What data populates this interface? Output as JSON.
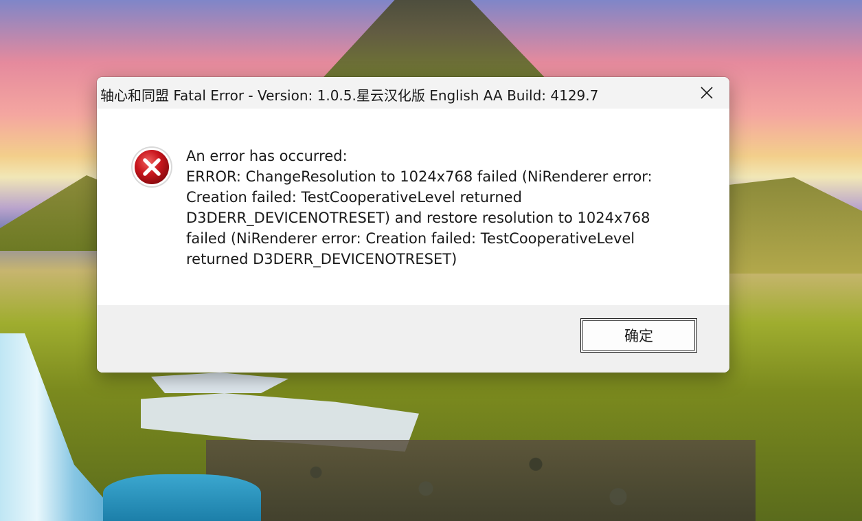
{
  "window": {
    "title": "轴心和同盟 Fatal Error - Version: 1.0.5.星云汉化版 English AA Build: 4129.7"
  },
  "dialog": {
    "icon": "error-icon",
    "message_lines": [
      "An error has occurred:",
      "ERROR: ChangeResolution to 1024x768 failed (NiRenderer error:",
      "Creation failed: TestCooperativeLevel returned",
      "D3DERR_DEVICENOTRESET) and restore resolution to 1024x768",
      "failed (NiRenderer error: Creation failed: TestCooperativeLevel",
      "returned D3DERR_DEVICENOTRESET)"
    ],
    "ok_label": "确定"
  },
  "colors": {
    "error_red": "#c8161d",
    "titlebar_bg": "#f3f3f3",
    "footer_bg": "#f0f0f0"
  }
}
